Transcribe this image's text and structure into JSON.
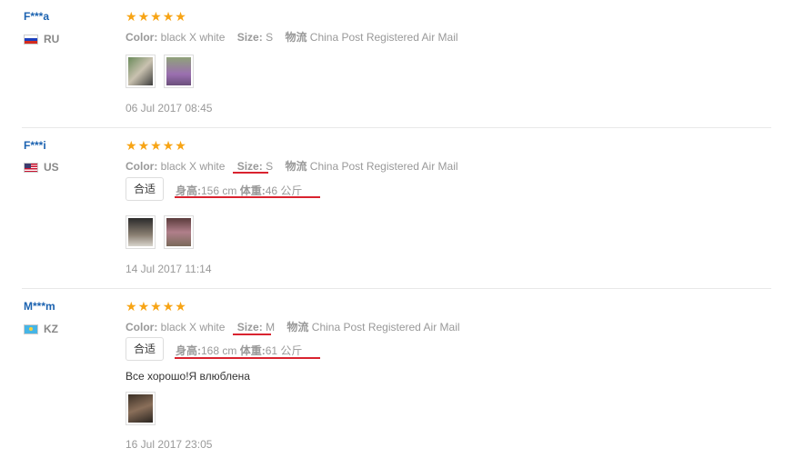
{
  "reviews": [
    {
      "user": "F***a",
      "country": "RU",
      "stars": 5,
      "color_label": "Color:",
      "color_value": "black X white",
      "size_label": "Size:",
      "size_value": "S",
      "shipping_label": "物流",
      "shipping_value": "China Post Registered Air Mail",
      "date": "06 Jul 2017 08:45",
      "photos": 2
    },
    {
      "user": "F***i",
      "country": "US",
      "stars": 5,
      "color_label": "Color:",
      "color_value": "black X white",
      "size_label": "Size:",
      "size_value": "S",
      "shipping_label": "物流",
      "shipping_value": "China Post Registered Air Mail",
      "fit": "合适",
      "height_label": "身高:",
      "height_value": "156 cm",
      "weight_label": "体重:",
      "weight_value": "46 公斤",
      "date": "14 Jul 2017 11:14",
      "photos": 2
    },
    {
      "user": "M***m",
      "country": "KZ",
      "stars": 5,
      "color_label": "Color:",
      "color_value": "black X white",
      "size_label": "Size:",
      "size_value": "M",
      "shipping_label": "物流",
      "shipping_value": "China Post Registered Air Mail",
      "fit": "合适",
      "height_label": "身高:",
      "height_value": "168 cm",
      "weight_label": "体重:",
      "weight_value": "61 公斤",
      "text": "Все хорошо!Я влюблена",
      "date": "16 Jul 2017 23:05",
      "photos": 1
    }
  ],
  "colors": {
    "star": "#f7a415",
    "username": "#1b62b0",
    "highlight": "#d9232f"
  }
}
